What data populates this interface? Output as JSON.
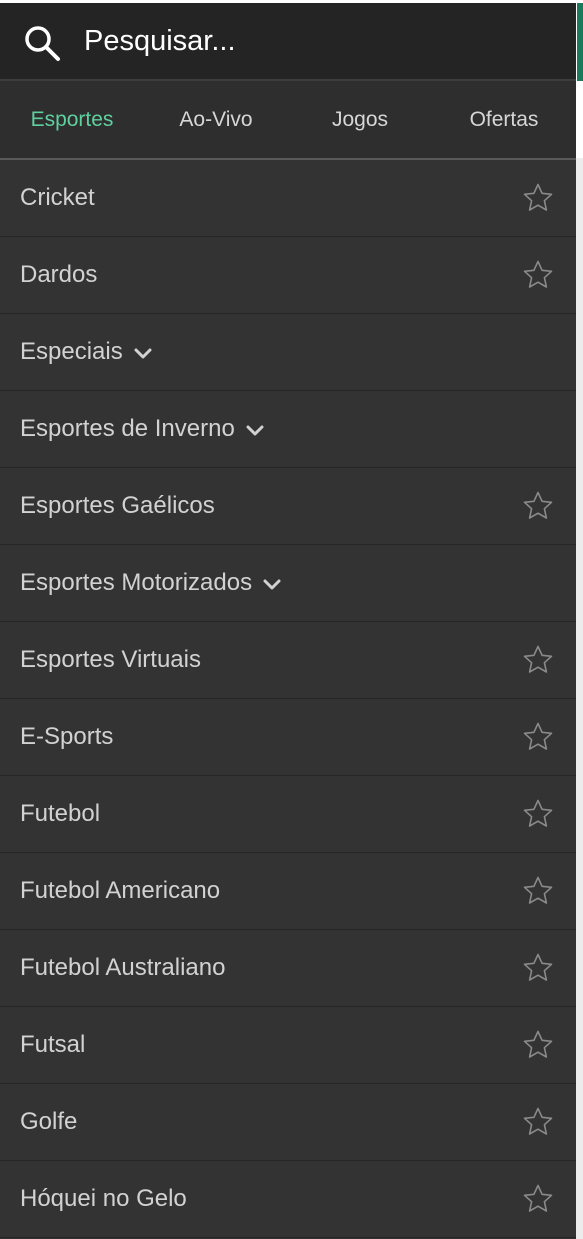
{
  "search": {
    "placeholder": "Pesquisar...",
    "icon": "search-icon"
  },
  "tabs": [
    {
      "label": "Esportes",
      "active": true
    },
    {
      "label": "Ao-Vivo",
      "active": false
    },
    {
      "label": "Jogos",
      "active": false
    },
    {
      "label": "Ofertas",
      "active": false
    }
  ],
  "sports": [
    {
      "label": "Cricket",
      "trailing": "star-icon"
    },
    {
      "label": "Dardos",
      "trailing": "star-icon"
    },
    {
      "label": "Especiais",
      "trailing": "chevron-down-icon"
    },
    {
      "label": "Esportes de Inverno",
      "trailing": "chevron-down-icon"
    },
    {
      "label": "Esportes Gaélicos",
      "trailing": "star-icon"
    },
    {
      "label": "Esportes Motorizados",
      "trailing": "chevron-down-icon"
    },
    {
      "label": "Esportes Virtuais",
      "trailing": "star-icon"
    },
    {
      "label": "E-Sports",
      "trailing": "star-icon"
    },
    {
      "label": "Futebol",
      "trailing": "star-icon"
    },
    {
      "label": "Futebol Americano",
      "trailing": "star-icon"
    },
    {
      "label": "Futebol Australiano",
      "trailing": "star-icon"
    },
    {
      "label": "Futsal",
      "trailing": "star-icon"
    },
    {
      "label": "Golfe",
      "trailing": "star-icon"
    },
    {
      "label": "Hóquei no Gelo",
      "trailing": "star-icon"
    }
  ],
  "colors": {
    "background": "#333333",
    "search_bar": "#242424",
    "accent": "#5fcf9e",
    "text": "#d2d2d2"
  }
}
